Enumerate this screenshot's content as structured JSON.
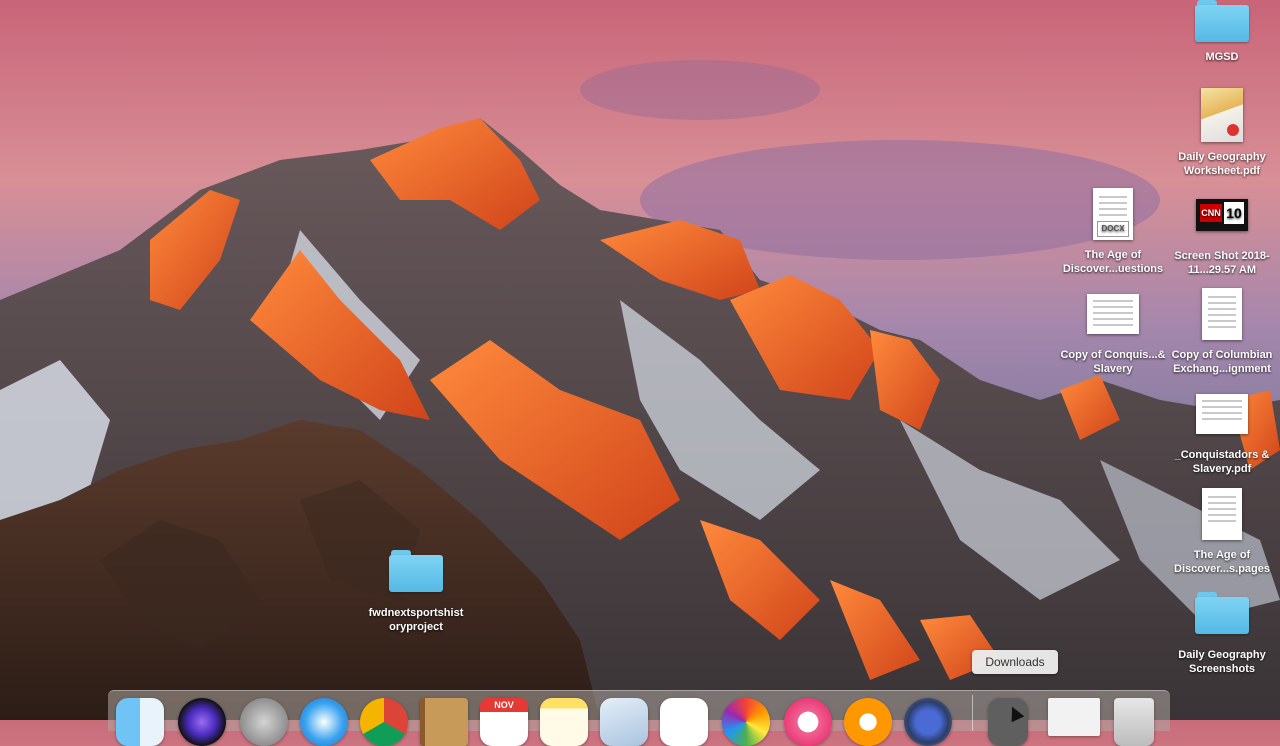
{
  "desktop": {
    "icons": [
      {
        "label": "MGSD",
        "kind": "folder"
      },
      {
        "label": "Daily Geography Worksheet.pdf",
        "kind": "pdf"
      },
      {
        "label": "The Age of Discover...uestions",
        "kind": "docx",
        "tag": "DOCX"
      },
      {
        "label": "Screen Shot 2018-11...29.57 AM",
        "kind": "image",
        "brand": "CNN",
        "number": "10"
      },
      {
        "label": "Copy of Conquis...& Slavery",
        "kind": "document"
      },
      {
        "label": "Copy of Columbian Exchang...ignment",
        "kind": "document"
      },
      {
        "label": "_Conquistadors & Slavery.pdf",
        "kind": "pdf"
      },
      {
        "label": "The Age of Discover...s.pages",
        "kind": "pages"
      },
      {
        "label": "Daily Geography Screenshots",
        "kind": "folder"
      },
      {
        "label": "fwdnextsportshistoryproject",
        "kind": "folder"
      }
    ]
  },
  "tooltip": {
    "text": "Downloads"
  },
  "dock": {
    "items": [
      {
        "name": "Finder",
        "icon": "finder-icon"
      },
      {
        "name": "Siri",
        "icon": "siri-icon"
      },
      {
        "name": "Launchpad",
        "icon": "launchpad-icon"
      },
      {
        "name": "Safari",
        "icon": "safari-icon"
      },
      {
        "name": "Chrome",
        "icon": "chrome-icon"
      },
      {
        "name": "Contacts",
        "icon": "contacts-icon"
      },
      {
        "name": "Calendar",
        "icon": "calendar-icon",
        "month": "NOV"
      },
      {
        "name": "Notes",
        "icon": "notes-icon"
      },
      {
        "name": "Preview",
        "icon": "preview-icon"
      },
      {
        "name": "Reminders",
        "icon": "reminders-icon"
      },
      {
        "name": "Photos",
        "icon": "photos-icon"
      },
      {
        "name": "iTunes",
        "icon": "itunes-icon"
      },
      {
        "name": "iBooks",
        "icon": "ibooks-icon"
      },
      {
        "name": "Screenshot",
        "icon": "screenshot-icon"
      },
      {
        "name": "Downloads",
        "icon": "downloads-stack-icon"
      },
      {
        "name": "Documents",
        "icon": "documents-stack-icon"
      },
      {
        "name": "Trash",
        "icon": "trash-icon"
      }
    ]
  }
}
